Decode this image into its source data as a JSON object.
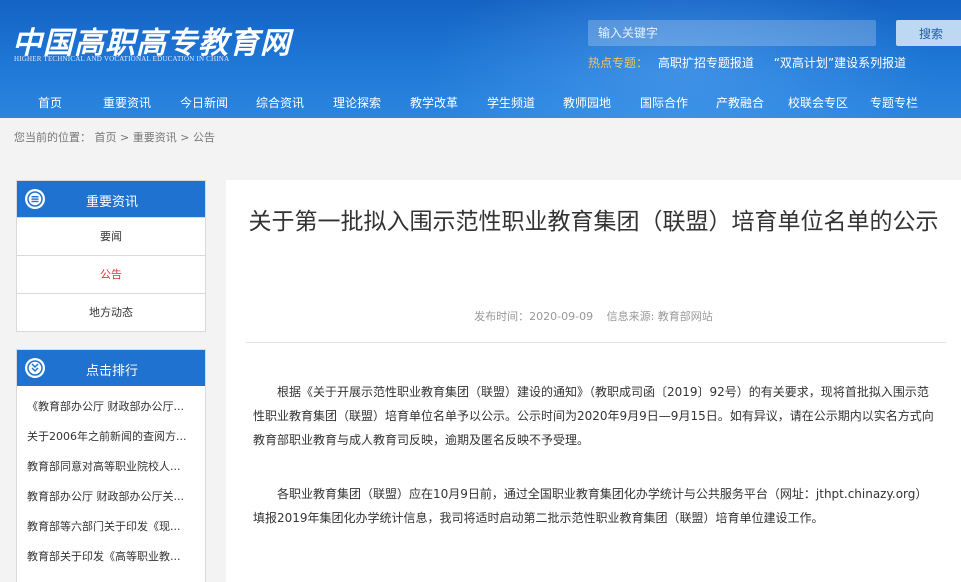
{
  "header": {
    "logo_cn": "中国高职高专教育网",
    "logo_en": "HIGHER TECHNICAL AND VOCATIONAL EDUCATION IN CHINA",
    "search_placeholder": "输入关键字",
    "search_button": "搜索",
    "hot_label": "热点专题：",
    "hot_links": [
      "高职扩招专题报道",
      "“双高计划”建设系列报道"
    ]
  },
  "nav": [
    "首页",
    "重要资讯",
    "今日新闻",
    "综合资讯",
    "理论探索",
    "教学改革",
    "学生频道",
    "教师园地",
    "国际合作",
    "产教融合",
    "校联会专区",
    "专题专栏"
  ],
  "breadcrumb": {
    "prefix": "您当前的位置：",
    "items": [
      "首页",
      "重要资讯",
      "公告"
    ],
    "sep": ">"
  },
  "sidebar": {
    "news_title": "重要资讯",
    "news_items": [
      "要闻",
      "公告",
      "地方动态"
    ],
    "rank_title": "点击排行",
    "rank_items": [
      "《教育部办公厅 财政部办公厅...",
      "关于2006年之前新闻的查阅方...",
      "教育部同意对高等职业院校人...",
      "教育部办公厅 财政部办公厅关...",
      "教育部等六部门关于印发《现...",
      "教育部关于印发《高等职业教..."
    ]
  },
  "article": {
    "title": "关于第一批拟入围示范性职业教育集团（联盟）培育单位名单的公示",
    "meta_date": "发布时间：2020-09-09",
    "meta_source": "信息来源: 教育部网站",
    "paragraphs": [
      "根据《关于开展示范性职业教育集团（联盟）建设的通知》（教职成司函〔2019〕92号）的有关要求，现将首批拟入围示范性职业教育集团（联盟）培育单位名单予以公示。公示时间为2020年9月9日—9月15日。如有异议，请在公示期内以实名方式向教育部职业教育与成人教育司反映，逾期及匿名反映不予受理。",
      "各职业教育集团（联盟）应在10月9日前，通过全国职业教育集团化办学统计与公共服务平台（网址：jthpt.chinazy.org）填报2019年集团化办学统计信息，我司将适时启动第二批示范性职业教育集团（联盟）培育单位建设工作。"
    ]
  },
  "colors": {
    "header_blue": "#1f77d6",
    "side_head_blue": "#1f72cf",
    "active_red": "#e6332a",
    "hot_label": "#f7c35b"
  }
}
